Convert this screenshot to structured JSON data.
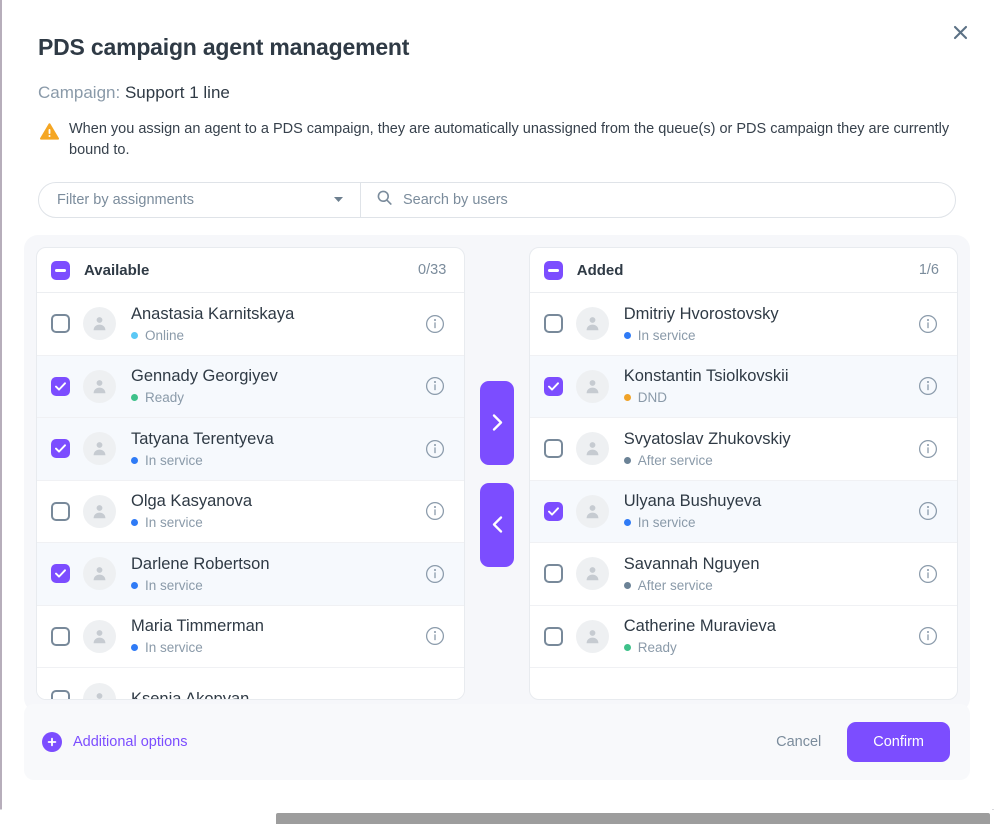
{
  "dialog": {
    "title": "PDS campaign agent management",
    "close_icon": "close-icon",
    "campaign_label": "Campaign:",
    "campaign_value": "Support 1 line",
    "warning_icon": "warning-triangle-icon",
    "warning_text": "When you assign an agent to a PDS campaign, they are automatically unassigned from the queue(s) or PDS campaign they are currently bound to."
  },
  "toolbar": {
    "filter_label": "Filter by assignments",
    "filter_caret_icon": "chevron-down-icon",
    "search_icon": "search-icon",
    "search_placeholder": "Search by users",
    "search_value": ""
  },
  "transfer": {
    "move_right_icon": "chevron-right-icon",
    "move_left_icon": "chevron-left-icon",
    "available": {
      "title": "Available",
      "count": "0/33",
      "header_checkbox_state": "indeterminate",
      "rows": [
        {
          "name": "Anastasia Karnitskaya",
          "status": "Online",
          "status_color": "#5bc8f5",
          "checked": false
        },
        {
          "name": "Gennady Georgiyev",
          "status": "Ready",
          "status_color": "#3ec18a",
          "checked": true
        },
        {
          "name": "Tatyana Terentyeva",
          "status": "In service",
          "status_color": "#2f7bf6",
          "checked": true
        },
        {
          "name": "Olga Kasyanova",
          "status": "In service",
          "status_color": "#2f7bf6",
          "checked": false
        },
        {
          "name": "Darlene Robertson",
          "status": "In service",
          "status_color": "#2f7bf6",
          "checked": true
        },
        {
          "name": "Maria Timmerman",
          "status": "In service",
          "status_color": "#2f7bf6",
          "checked": false
        },
        {
          "name": "Ksenia Akopyan",
          "status": "",
          "status_color": "#2f7bf6",
          "checked": false
        }
      ]
    },
    "added": {
      "title": "Added",
      "count": "1/6",
      "header_checkbox_state": "indeterminate",
      "rows": [
        {
          "name": "Dmitriy Hvorostovsky",
          "status": "In service",
          "status_color": "#2f7bf6",
          "checked": false
        },
        {
          "name": "Konstantin Tsiolkovskii",
          "status": "DND",
          "status_color": "#f0a329",
          "checked": true
        },
        {
          "name": "Svyatoslav Zhukovskiy",
          "status": "After service",
          "status_color": "#6b8296",
          "checked": false
        },
        {
          "name": "Ulyana Bushuyeva",
          "status": "In service",
          "status_color": "#2f7bf6",
          "checked": true
        },
        {
          "name": "Savannah Nguyen",
          "status": "After service",
          "status_color": "#6b8296",
          "checked": false
        },
        {
          "name": "Catherine Muravieva",
          "status": "Ready",
          "status_color": "#3ec18a",
          "checked": false
        }
      ]
    },
    "row_info_icon": "info-icon",
    "row_avatar_icon": "avatar-icon"
  },
  "footer": {
    "additional_options_label": "Additional options",
    "additional_options_icon": "plus-circle-icon",
    "cancel_label": "Cancel",
    "confirm_label": "Confirm"
  },
  "colors": {
    "accent": "#7c4dff",
    "warning": "#f5a623",
    "text": "#2f3a45",
    "muted": "#7b8c9c",
    "panel_bg": "#f6f7fa",
    "selected_row": "#f6f9fd"
  }
}
